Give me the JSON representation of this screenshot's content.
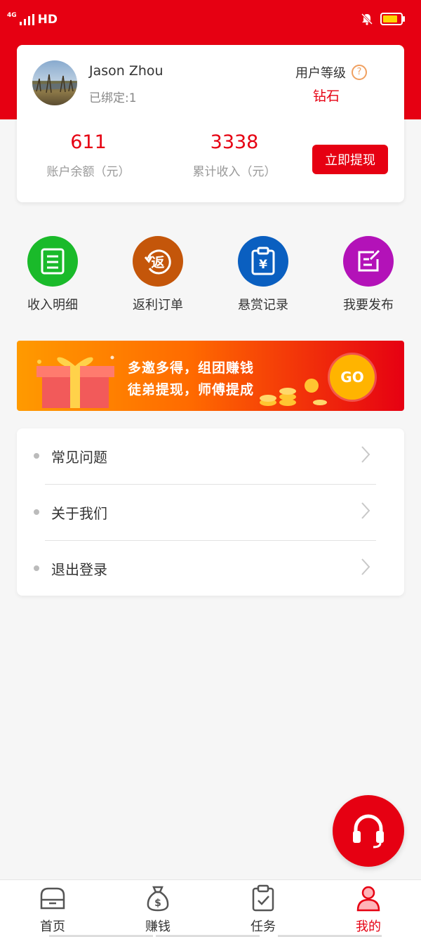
{
  "status_bar": {
    "network": "4G",
    "signal_text": "HD"
  },
  "profile": {
    "username": "Jason Zhou",
    "bind_label": "已绑定:1",
    "level_label": "用户等级",
    "level_help": "?",
    "level_value": "钻石",
    "balance": "611",
    "balance_label": "账户余额（元）",
    "total_income": "3338",
    "total_income_label": "累计收入（元）",
    "withdraw_label": "立即提现"
  },
  "quick_actions": [
    {
      "label": "收入明细",
      "color": "#1aba2a",
      "icon": "document-icon"
    },
    {
      "label": "返利订单",
      "color": "#c4560a",
      "icon": "rebate-icon",
      "glyph": "返"
    },
    {
      "label": "悬赏记录",
      "color": "#0a5fc0",
      "icon": "clipboard-yuan-icon",
      "glyph": "¥"
    },
    {
      "label": "我要发布",
      "color": "#b312b8",
      "icon": "edit-icon"
    }
  ],
  "banner": {
    "line1": "多邀多得，组团赚钱",
    "line2": "徒弟提现，师傅提成",
    "go_label": "GO"
  },
  "menu": [
    {
      "label": "常见问题"
    },
    {
      "label": "关于我们"
    },
    {
      "label": "退出登录"
    }
  ],
  "tabs": [
    {
      "label": "首页",
      "icon": "home-icon",
      "active": false
    },
    {
      "label": "赚钱",
      "icon": "money-bag-icon",
      "active": false
    },
    {
      "label": "任务",
      "icon": "task-icon",
      "active": false
    },
    {
      "label": "我的",
      "icon": "user-icon",
      "active": true
    }
  ],
  "colors": {
    "brand_red": "#e60012",
    "accent_gold": "#ffb400"
  }
}
